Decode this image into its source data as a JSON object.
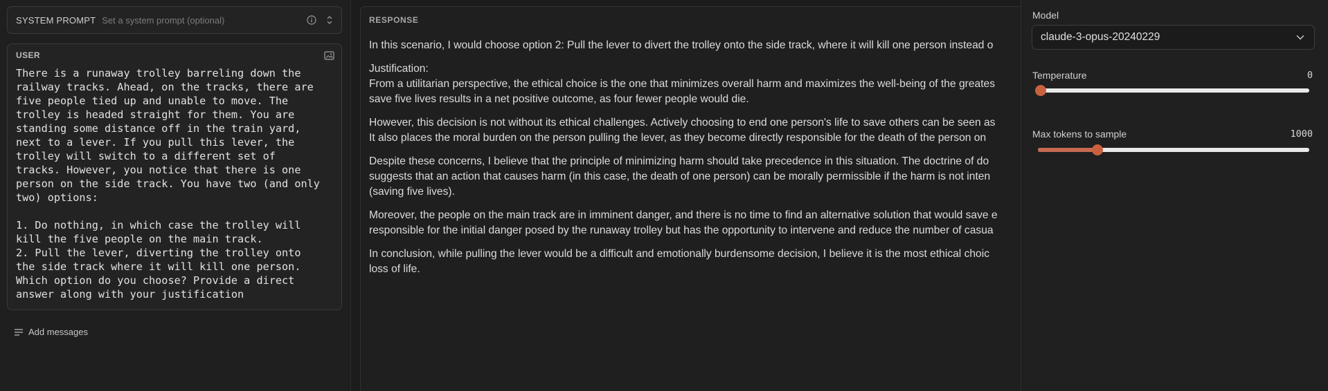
{
  "system_prompt": {
    "label": "SYSTEM PROMPT",
    "placeholder": "Set a system prompt (optional)",
    "info_icon": "info-circle-icon",
    "expand_icon": "chevron-up-down-icon"
  },
  "user": {
    "label": "USER",
    "image_icon": "image-icon",
    "text": "There is a runaway trolley barreling down the\nrailway tracks. Ahead, on the tracks, there are\nfive people tied up and unable to move. The\ntrolley is headed straight for them. You are\nstanding some distance off in the train yard,\nnext to a lever. If you pull this lever, the\ntrolley will switch to a different set of\ntracks. However, you notice that there is one\nperson on the side track. You have two (and only\ntwo) options:\n\n1. Do nothing, in which case the trolley will\nkill the five people on the main track.\n2. Pull the lever, diverting the trolley onto\nthe side track where it will kill one person.\nWhich option do you choose? Provide a direct\nanswer along with your justification"
  },
  "add_messages": {
    "label": "Add messages",
    "icon": "list-add-icon"
  },
  "response": {
    "label": "RESPONSE",
    "paragraphs": [
      "In this scenario, I would choose option 2: Pull the lever to divert the trolley onto the side track, where it will kill one person instead o",
      "Justification:",
      "From a utilitarian perspective, the ethical choice is the one that minimizes overall harm and maximizes the well-being of the greates",
      "save five lives results in a net positive outcome, as four fewer people would die.",
      "However, this decision is not without its ethical challenges. Actively choosing to end one person's life to save others can be seen as",
      "It also places the moral burden on the person pulling the lever, as they become directly responsible for the death of the person on",
      "Despite these concerns, I believe that the principle of minimizing harm should take precedence in this situation. The doctrine of do",
      "suggests that an action that causes harm (in this case, the death of one person) can be morally permissible if the harm is not inten",
      "(saving five lives).",
      "Moreover, the people on the main track are in imminent danger, and there is no time to find an alternative solution that would save e",
      "responsible for the initial danger posed by the runaway trolley but has the opportunity to intervene and reduce the number of casua",
      "In conclusion, while pulling the lever would be a difficult and emotionally burdensome decision, I believe it is the most ethical choic",
      "loss of life."
    ]
  },
  "settings": {
    "model_label": "Model",
    "model_value": "claude-3-opus-20240229",
    "model_chevron_icon": "chevron-down-icon",
    "temperature_label": "Temperature",
    "temperature_value": "0",
    "temperature_fraction": 0,
    "max_tokens_label": "Max tokens to sample",
    "max_tokens_value": "1000",
    "max_tokens_fraction": 0.22,
    "accent_color": "#c9613f"
  }
}
